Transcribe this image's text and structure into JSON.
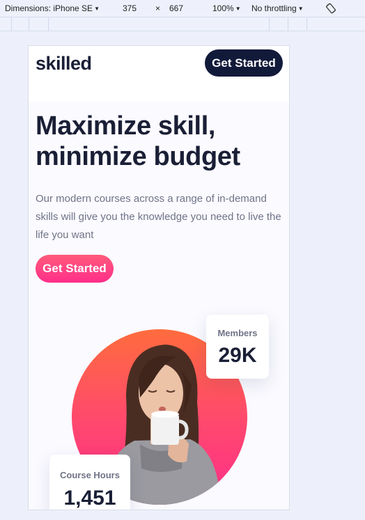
{
  "devtools": {
    "dimensions_label": "Dimensions: iPhone SE",
    "width": "375",
    "times": "×",
    "height": "667",
    "zoom": "100%",
    "throttling": "No throttling",
    "caret_icon": "caret-down-icon",
    "rotate_icon": "rotate-icon"
  },
  "site": {
    "logo": "skilled",
    "header_button": "Get Started",
    "hero": {
      "title": "Maximize skill, minimize budget",
      "description": "Our modern courses across a range of in-demand skills will give you the knowledge you need to live the life you want",
      "cta": "Get Started"
    },
    "stats": {
      "members_label": "Members",
      "members_value": "29K",
      "hours_label": "Course Hours",
      "hours_value": "1,451"
    },
    "image_alt": "woman drinking from a mug"
  },
  "colors": {
    "dark_navy": "#121a3a",
    "heading": "#1a1f36",
    "text_muted": "#707386",
    "gradient_top": "#ff6c3d",
    "gradient_bottom": "#ff2e8a",
    "page_bg": "#fafaff"
  }
}
